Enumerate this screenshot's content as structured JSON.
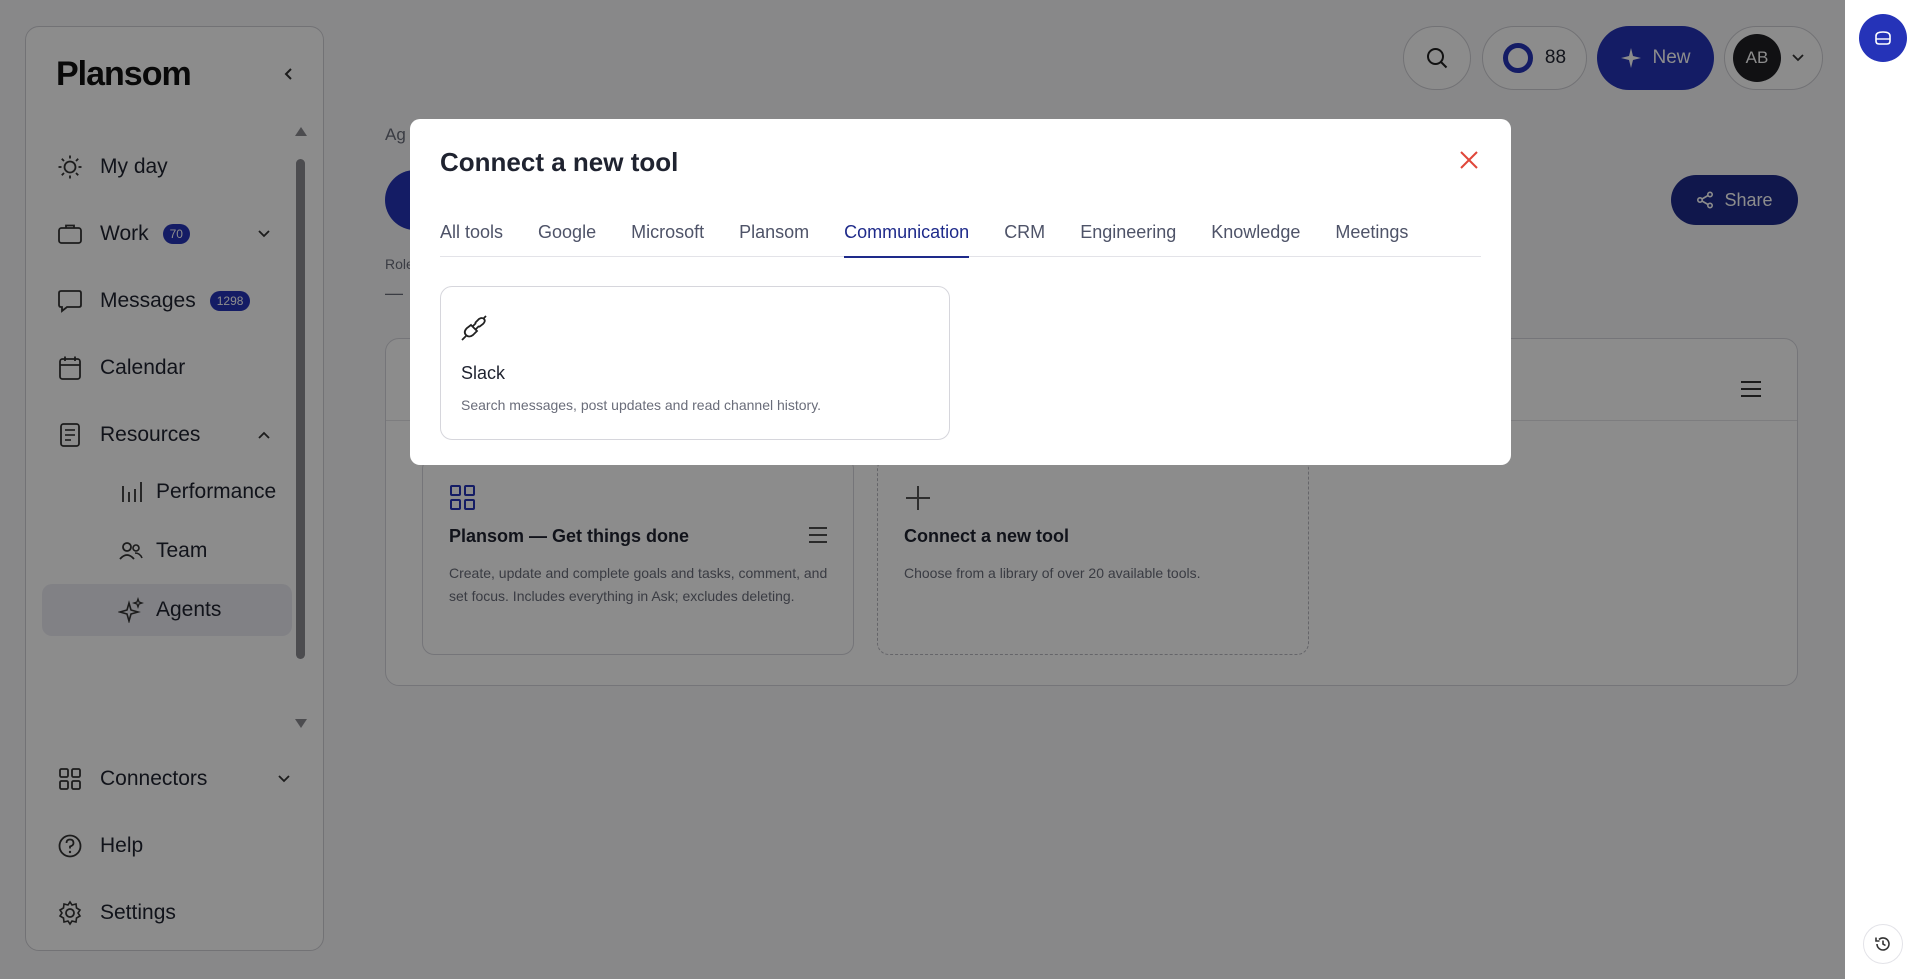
{
  "app": {
    "logo": "Plansom",
    "colors": {
      "accent": "#2533b8",
      "accent_dark": "#1e2a8a",
      "close": "#e0473a"
    }
  },
  "sidebar": {
    "items": [
      {
        "label": "My day",
        "icon": "sun-icon"
      },
      {
        "label": "Work",
        "icon": "briefcase-icon",
        "badge": "70"
      },
      {
        "label": "Messages",
        "icon": "chat-bubble-icon",
        "badge": "1298"
      },
      {
        "label": "Calendar",
        "icon": "calendar-icon"
      },
      {
        "label": "Resources",
        "icon": "document-icon"
      }
    ],
    "sub_items": [
      {
        "label": "Performance",
        "icon": "bar-chart-icon"
      },
      {
        "label": "Team",
        "icon": "team-icon"
      },
      {
        "label": "Agents",
        "icon": "sparkle-icon",
        "active": true
      }
    ],
    "bottom_items": [
      {
        "label": "Connectors",
        "icon": "grid-icon"
      },
      {
        "label": "Help",
        "icon": "help-circle-icon"
      },
      {
        "label": "Settings",
        "icon": "gear-icon"
      }
    ]
  },
  "header": {
    "score": "88",
    "new_label": "New",
    "avatar_initials": "AB"
  },
  "page": {
    "breadcrumb_fragment": "Ag",
    "role_label": "Role",
    "role_value": "—",
    "share_label": "Share"
  },
  "cards": [
    {
      "title": "Plansom — Get things done",
      "description": "Create, update and complete goals and tasks, comment, and set focus. Includes everything in Ask; excludes deleting."
    },
    {
      "title": "Connect a new tool",
      "description": "Choose from a library of over 20 available tools."
    }
  ],
  "modal": {
    "title": "Connect a new tool",
    "tabs": [
      {
        "label": "All tools"
      },
      {
        "label": "Google"
      },
      {
        "label": "Microsoft"
      },
      {
        "label": "Plansom"
      },
      {
        "label": "Communication",
        "active": true
      },
      {
        "label": "CRM"
      },
      {
        "label": "Engineering"
      },
      {
        "label": "Knowledge"
      },
      {
        "label": "Meetings"
      }
    ],
    "tools": [
      {
        "name": "Slack",
        "description": "Search messages, post updates and read channel history.",
        "icon": "plug-icon"
      }
    ]
  }
}
